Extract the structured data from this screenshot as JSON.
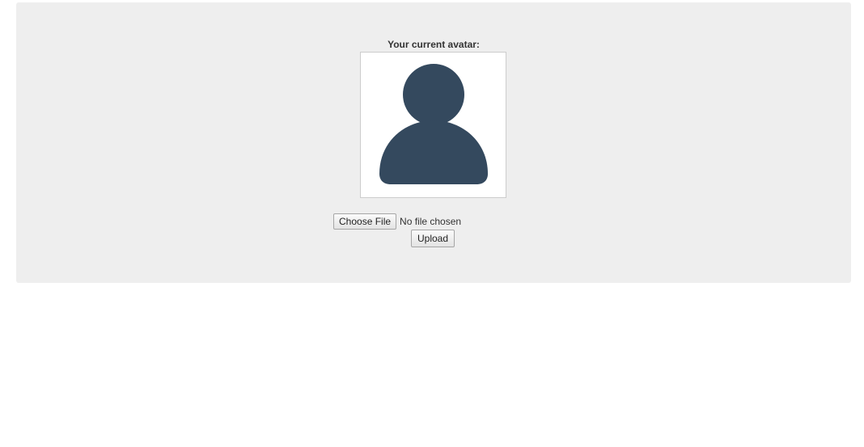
{
  "avatar_section": {
    "title": "Your current avatar:",
    "avatar_icon": "user-silhouette-icon",
    "avatar_color": "#34495e"
  },
  "file_input": {
    "button_label": "Choose File",
    "status_text": "No file chosen"
  },
  "upload": {
    "button_label": "Upload"
  }
}
